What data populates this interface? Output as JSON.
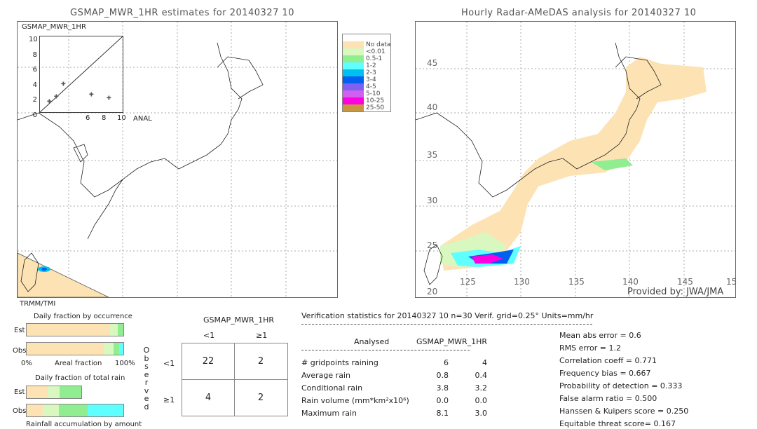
{
  "left_map": {
    "title": "GSMAP_MWR_1HR estimates for 20140327 10",
    "inset_title": "GSMAP_MWR_1HR",
    "inset_y_ticks": [
      "10",
      "8",
      "6",
      "4",
      "2",
      "0"
    ],
    "inset_x_ticks": [
      "6",
      "8",
      "10"
    ],
    "inset_xlabel": "ANAL",
    "sensor": "TRMM/TMI"
  },
  "right_map": {
    "title": "Hourly Radar-AMeDAS analysis for 20140327 10",
    "lat_labels": [
      "45",
      "40",
      "35",
      "30",
      "25",
      "20"
    ],
    "lon_labels": [
      "125",
      "130",
      "135",
      "140",
      "145",
      "15"
    ],
    "credit": "Provided by: JWA/JMA"
  },
  "legend": [
    {
      "label": "",
      "color": "#ffffff"
    },
    {
      "label": "No data",
      "color": "#fde3b4"
    },
    {
      "label": "<0.01",
      "color": "#d8f8c0"
    },
    {
      "label": "0.5-1",
      "color": "#90ee90"
    },
    {
      "label": "1-2",
      "color": "#60ffff"
    },
    {
      "label": "2-3",
      "color": "#00c0f0"
    },
    {
      "label": "3-4",
      "color": "#0060f0"
    },
    {
      "label": "4-5",
      "color": "#8060f0"
    },
    {
      "label": "5-10",
      "color": "#d060f0"
    },
    {
      "label": "10-25",
      "color": "#ff00e0"
    },
    {
      "label": "25-50",
      "color": "#c89640"
    }
  ],
  "fraction": {
    "occurrence_title": "Daily fraction by occurrence",
    "est": "Est",
    "obs": "Obs",
    "zero": "0%",
    "axis": "Areal fraction",
    "hundred": "100%",
    "total_title": "Daily fraction of total rain",
    "amount_title": "Rainfall accumulation by amount",
    "occ_est": [
      {
        "pct": 86,
        "color": "#fde3b4"
      },
      {
        "pct": 8,
        "color": "#d8f8c0"
      },
      {
        "pct": 6,
        "color": "#90ee90"
      }
    ],
    "occ_obs": [
      {
        "pct": 80,
        "color": "#fde3b4"
      },
      {
        "pct": 10,
        "color": "#d8f8c0"
      },
      {
        "pct": 6,
        "color": "#90ee90"
      },
      {
        "pct": 4,
        "color": "#60ffff"
      }
    ],
    "tot_est": [
      {
        "pct": 22,
        "color": "#fde3b4"
      },
      {
        "pct": 12,
        "color": "#d8f8c0"
      },
      {
        "pct": 23,
        "color": "#90ee90"
      }
    ],
    "tot_obs": [
      {
        "pct": 17,
        "color": "#fde3b4"
      },
      {
        "pct": 16,
        "color": "#d8f8c0"
      },
      {
        "pct": 30,
        "color": "#90ee90"
      },
      {
        "pct": 37,
        "color": "#60ffff"
      }
    ]
  },
  "contingency": {
    "title": "GSMAP_MWR_1HR",
    "col_lt": "<1",
    "col_ge": "≥1",
    "row_lt": "<1",
    "row_ge": "≥1",
    "observed": [
      "O",
      "b",
      "s",
      "e",
      "r",
      "v",
      "e",
      "d"
    ],
    "cells": [
      "22",
      "2",
      "4",
      "2"
    ]
  },
  "stats": {
    "header": "Verification statistics for 20140327 10   n=30   Verif. grid=0.25°   Units=mm/hr",
    "col1": "Analysed",
    "col2": "GSMAP_MWR_1HR",
    "rows": [
      {
        "label": "# gridpoints raining",
        "a": "6",
        "b": "4"
      },
      {
        "label": "Average rain",
        "a": "0.8",
        "b": "0.4"
      },
      {
        "label": "Conditional rain",
        "a": "3.8",
        "b": "3.2"
      },
      {
        "label": "Rain volume (mm*km²x10⁶)",
        "a": "0.0",
        "b": "0.0"
      },
      {
        "label": "Maximum rain",
        "a": "8.1",
        "b": "3.0"
      }
    ],
    "scores": [
      "Mean abs error = 0.6",
      "RMS error = 1.2",
      "Correlation coeff = 0.771",
      "Frequency bias = 0.667",
      "Probability of detection = 0.333",
      "False alarm ratio = 0.500",
      "Hanssen & Kuipers score = 0.250",
      "Equitable threat score= 0.167"
    ]
  }
}
